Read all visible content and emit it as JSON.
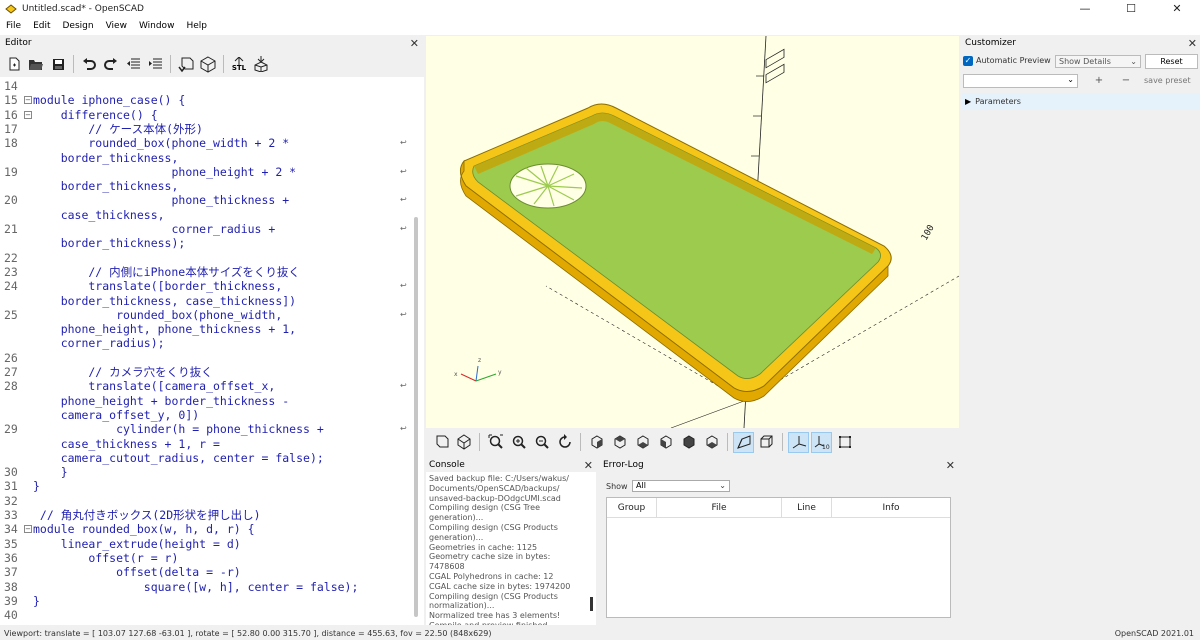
{
  "window": {
    "title": "Untitled.scad* - OpenSCAD",
    "minimize": "—",
    "maximize": "☐",
    "close": "✕"
  },
  "menu": [
    "File",
    "Edit",
    "Design",
    "View",
    "Window",
    "Help"
  ],
  "editor": {
    "header": "Editor",
    "close": "✕",
    "toolbar_icons": [
      "new-file-icon",
      "open-file-icon",
      "save-icon",
      "undo-icon",
      "redo-icon",
      "unindent-icon",
      "indent-icon",
      "preview-icon",
      "render-icon",
      "export-stl-icon",
      "send-to-printer-icon"
    ],
    "stl_label": "STL",
    "lines": [
      {
        "n": "14",
        "text": ""
      },
      {
        "n": "15",
        "text": "module iphone_case() {",
        "fold": true
      },
      {
        "n": "16",
        "text": "    difference() {",
        "fold": true
      },
      {
        "n": "17",
        "text": "        // ケース本体(外形)"
      },
      {
        "n": "18",
        "text": "        rounded_box(phone_width + 2 *",
        "wrap": true
      },
      {
        "n": "",
        "text": "    border_thickness,"
      },
      {
        "n": "19",
        "text": "                    phone_height + 2 *",
        "wrap": true
      },
      {
        "n": "",
        "text": "    border_thickness,"
      },
      {
        "n": "20",
        "text": "                    phone_thickness +",
        "wrap": true
      },
      {
        "n": "",
        "text": "    case_thickness,"
      },
      {
        "n": "21",
        "text": "                    corner_radius +",
        "wrap": true
      },
      {
        "n": "",
        "text": "    border_thickness);"
      },
      {
        "n": "22",
        "text": ""
      },
      {
        "n": "23",
        "text": "        // 内側にiPhone本体サイズをくり抜く"
      },
      {
        "n": "24",
        "text": "        translate([border_thickness,",
        "wrap": true
      },
      {
        "n": "",
        "text": "    border_thickness, case_thickness])"
      },
      {
        "n": "25",
        "text": "            rounded_box(phone_width,",
        "wrap": true
      },
      {
        "n": "",
        "text": "    phone_height, phone_thickness + 1,"
      },
      {
        "n": "",
        "text": "    corner_radius);"
      },
      {
        "n": "26",
        "text": ""
      },
      {
        "n": "27",
        "text": "        // カメラ穴をくり抜く"
      },
      {
        "n": "28",
        "text": "        translate([camera_offset_x,",
        "wrap": true
      },
      {
        "n": "",
        "text": "    phone_height + border_thickness -"
      },
      {
        "n": "",
        "text": "    camera_offset_y, 0])"
      },
      {
        "n": "29",
        "text": "            cylinder(h = phone_thickness +",
        "wrap": true
      },
      {
        "n": "",
        "text": "    case_thickness + 1, r ="
      },
      {
        "n": "",
        "text": "    camera_cutout_radius, center = false);"
      },
      {
        "n": "30",
        "text": "    }"
      },
      {
        "n": "31",
        "text": "}"
      },
      {
        "n": "32",
        "text": ""
      },
      {
        "n": "33",
        "text": " // 角丸付きボックス(2D形状を押し出し)"
      },
      {
        "n": "34",
        "text": "module rounded_box(w, h, d, r) {",
        "fold": true
      },
      {
        "n": "35",
        "text": "    linear_extrude(height = d)"
      },
      {
        "n": "36",
        "text": "        offset(r = r)"
      },
      {
        "n": "37",
        "text": "            offset(delta = -r)"
      },
      {
        "n": "38",
        "text": "                square([w, h], center = false);"
      },
      {
        "n": "39",
        "text": "}"
      },
      {
        "n": "40",
        "text": ""
      }
    ]
  },
  "viewport": {
    "axis_ticks": [
      "100",
      "100"
    ],
    "mini_axes": {
      "z": "z",
      "x": "x",
      "y": "y"
    },
    "case_color": "#f5c518",
    "face_color": "#9ccb4e",
    "background": "#ffffe5"
  },
  "view_toolbar_icons": [
    "preview-icon",
    "render-icon",
    "view-all-icon",
    "zoom-in-icon",
    "zoom-out-icon",
    "reset-view-icon",
    "view-right-icon",
    "view-top-icon",
    "view-bottom-icon",
    "view-left-icon",
    "view-front-icon",
    "view-back-icon",
    "perspective-icon",
    "orthogonal-icon",
    "show-axes-icon",
    "show-scale-markers-icon",
    "show-edges-icon"
  ],
  "console": {
    "header": "Console",
    "close": "✕",
    "lines": [
      "Saved backup file: C:/Users/wakus/",
      "Documents/OpenSCAD/backups/",
      "unsaved-backup-DOdgcUMI.scad",
      "Compiling design (CSG Tree",
      "generation)...",
      "Compiling design (CSG Products",
      "generation)...",
      "Geometries in cache: 1125",
      "Geometry cache size in bytes:",
      "7478608",
      "CGAL Polyhedrons in cache: 12",
      "CGAL cache size in bytes: 1974200",
      "Compiling design (CSG Products",
      "normalization)...",
      "Normalized tree has 3 elements!",
      "Compile and preview finished."
    ]
  },
  "error_log": {
    "header": "Error-Log",
    "close": "✕",
    "show_label": "Show",
    "show_value": "All",
    "columns": [
      "Group",
      "File",
      "Line",
      "Info"
    ]
  },
  "customizer": {
    "header": "Customizer",
    "close": "✕",
    "auto_preview_label": "Automatic Preview",
    "auto_preview_checked": true,
    "details_value": "Show Details",
    "reset_label": "Reset",
    "preset_value": "",
    "add_label": "+",
    "remove_label": "−",
    "save_preset_label": "save preset",
    "parameters_label": "Parameters"
  },
  "status": {
    "viewport_text": "Viewport: translate = [ 103.07 127.68 -63.01 ], rotate = [ 52.80 0.00 315.70 ], distance = 455.63, fov = 22.50 (848x629)",
    "version": "OpenSCAD 2021.01"
  }
}
